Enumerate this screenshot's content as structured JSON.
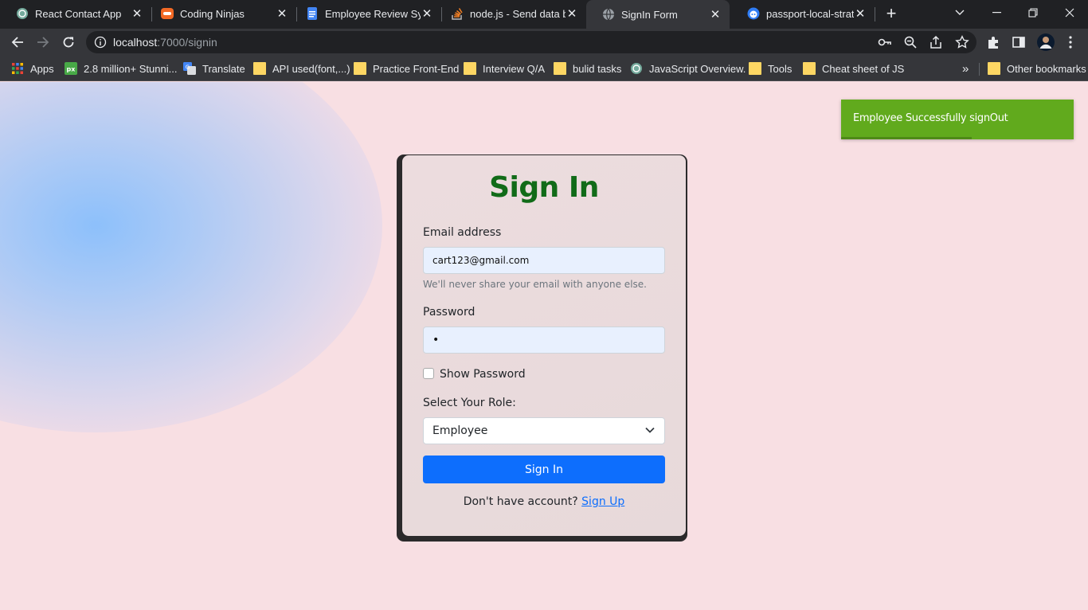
{
  "browser": {
    "tabs": [
      {
        "title": "React Contact App",
        "icon": "openai-icon"
      },
      {
        "title": "Coding Ninjas",
        "icon": "coding-ninjas-icon"
      },
      {
        "title": "Employee Review Syst",
        "icon": "google-docs-icon"
      },
      {
        "title": "node.js - Send data ba",
        "icon": "stackoverflow-icon"
      },
      {
        "title": "SignIn Form",
        "icon": "globe-icon",
        "active": true
      },
      {
        "title": "passport-local-strateg",
        "icon": "github-icon"
      }
    ],
    "close_glyph": "✕",
    "new_tab_glyph": "+",
    "url": {
      "host": "localhost",
      "path": ":7000/signin"
    },
    "bookmarks": [
      {
        "label": "Apps",
        "icon": "apps-grid-icon"
      },
      {
        "label": "2.8 million+ Stunni...",
        "icon": "pixabay-icon"
      },
      {
        "label": "Translate",
        "icon": "google-translate-icon"
      },
      {
        "label": "API used(font,...)",
        "icon": "folder-icon"
      },
      {
        "label": "Practice Front-End",
        "icon": "folder-icon"
      },
      {
        "label": "Interview Q/A",
        "icon": "folder-icon"
      },
      {
        "label": "bulid tasks",
        "icon": "folder-icon"
      },
      {
        "label": "JavaScript Overview.",
        "icon": "openai-icon"
      },
      {
        "label": "Tools",
        "icon": "folder-icon"
      },
      {
        "label": "Cheat sheet of JS",
        "icon": "folder-icon"
      }
    ],
    "bookmarks_overflow": "»",
    "other_bookmarks": "Other bookmarks"
  },
  "toast": {
    "message": "Employee Successfully signOut",
    "progress": 0.56,
    "color": "#61aa1d"
  },
  "form": {
    "title": "Sign In",
    "email_label": "Email address",
    "email_value": "cart123@gmail.com",
    "email_help": "We'll never share your email with anyone else.",
    "password_label": "Password",
    "password_value": "•",
    "show_password_label": "Show Password",
    "role_label": "Select Your Role:",
    "role_selected": "Employee",
    "submit_label": "Sign In",
    "footer_text": "Don't have account?",
    "signup_link": "Sign Up"
  },
  "colors": {
    "page_bg": "#f8dfe3",
    "title": "#116b18",
    "primary": "#0d6efd",
    "chrome_dark": "#202124",
    "chrome_toolbar": "#35363a"
  }
}
